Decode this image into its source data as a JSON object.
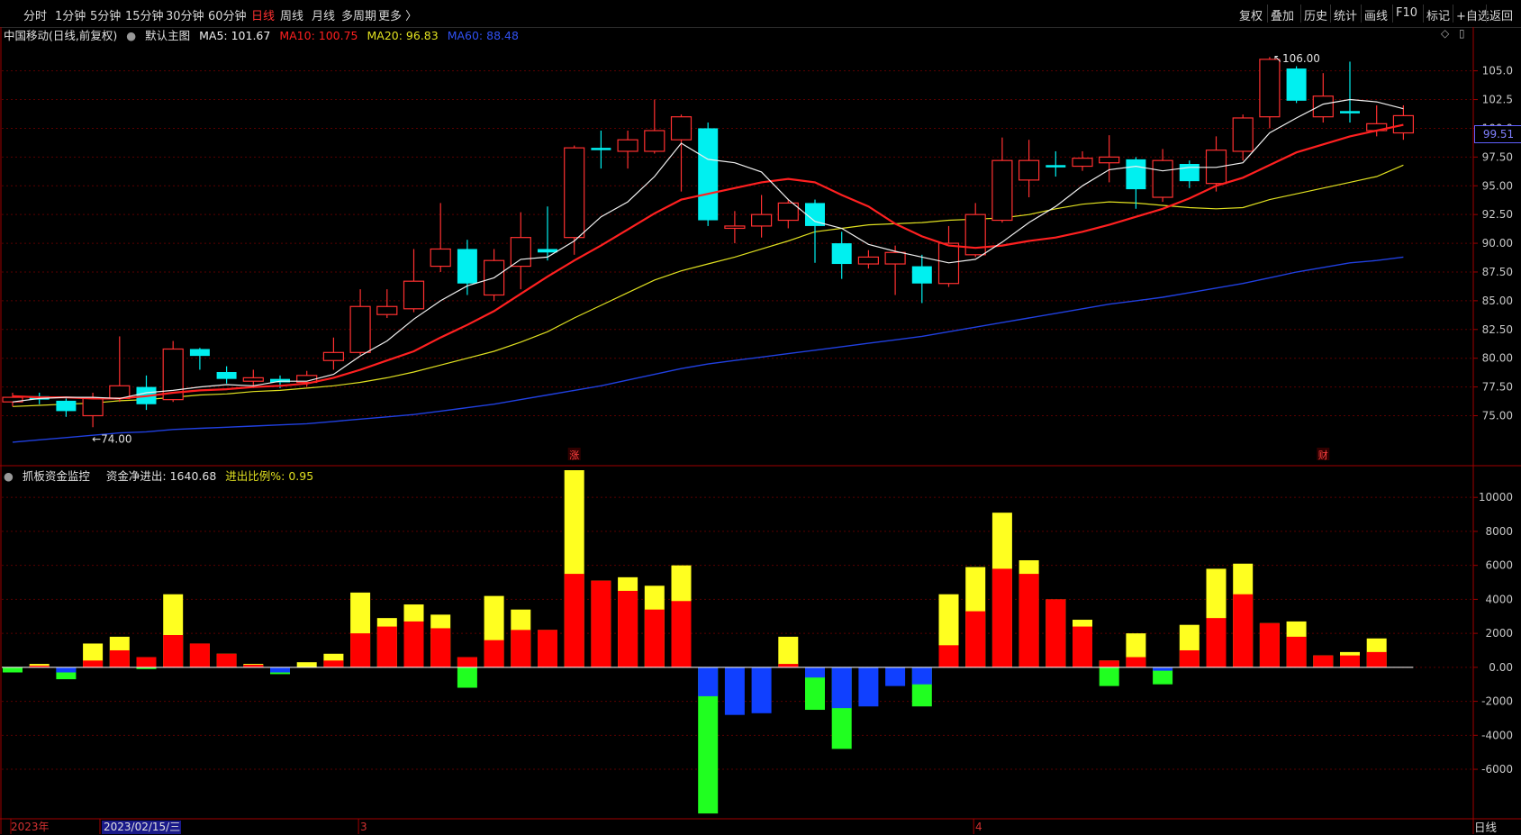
{
  "toolbar": {
    "periods": [
      "分时",
      "1分钟",
      "5分钟",
      "15分钟",
      "30分钟",
      "60分钟",
      "日线",
      "周线",
      "月线",
      "多周期",
      "更多 〉"
    ],
    "active_period": "日线",
    "right_buttons": [
      "复权",
      "叠加",
      "历史",
      "统计",
      "画线",
      "F10",
      "标记",
      "+自选",
      "返回"
    ]
  },
  "main_header": {
    "symbol": "中国移动(日线,前复权)",
    "template": "默认主图",
    "ma5": "MA5: 101.67",
    "ma10": "MA10: 100.75",
    "ma20": "MA20: 96.83",
    "ma60": "MA60: 88.48"
  },
  "sub_header": {
    "indicator": "抓板资金监控",
    "net_flow": "资金净进出: 1640.68",
    "ratio": "进出比例%: 0.95"
  },
  "current_price_tag": "99.51",
  "high_marker": "106.00",
  "low_marker": "←74.00",
  "event_markers": [
    "涨",
    "财"
  ],
  "x_labels": [
    "2023年",
    "2023/02/15/三",
    "3",
    "4"
  ],
  "freq_label": "日线",
  "colors": {
    "up": "#ff3030",
    "down": "#00f0f0",
    "ma5": "#f0f0f0",
    "ma10": "#ff2020",
    "ma20": "#e0e020",
    "ma60": "#2040e0",
    "bar_red": "#ff0000",
    "bar_yellow": "#ffff20",
    "bar_blue": "#1040ff",
    "bar_green": "#20ff20"
  },
  "chart_data": [
    {
      "type": "candlestick",
      "title": "中国移动(日线,前复权)",
      "y_ticks": [
        "105.0",
        "102.5",
        "100.0",
        "97.50",
        "95.00",
        "92.50",
        "90.00",
        "87.50",
        "85.00",
        "82.50",
        "80.00",
        "77.50",
        "75.00"
      ],
      "ylim": [
        71.2,
        107.4
      ],
      "candles": [
        {
          "o": 76.2,
          "c": 76.6,
          "h": 77.0,
          "l": 75.8
        },
        {
          "o": 76.7,
          "c": 76.4,
          "h": 77.0,
          "l": 76.0
        },
        {
          "o": 76.3,
          "c": 75.4,
          "h": 76.5,
          "l": 74.9
        },
        {
          "o": 75.0,
          "c": 76.5,
          "h": 77.0,
          "l": 74.0
        },
        {
          "o": 76.5,
          "c": 77.6,
          "h": 81.9,
          "l": 76.2
        },
        {
          "o": 77.5,
          "c": 76.0,
          "h": 78.5,
          "l": 75.5
        },
        {
          "o": 76.4,
          "c": 80.8,
          "h": 81.5,
          "l": 76.2
        },
        {
          "o": 80.8,
          "c": 80.2,
          "h": 80.9,
          "l": 79.0
        },
        {
          "o": 78.8,
          "c": 78.2,
          "h": 79.3,
          "l": 77.8
        },
        {
          "o": 78.0,
          "c": 78.3,
          "h": 79.0,
          "l": 77.4
        },
        {
          "o": 78.2,
          "c": 77.9,
          "h": 78.5,
          "l": 77.4
        },
        {
          "o": 77.9,
          "c": 78.5,
          "h": 78.9,
          "l": 77.5
        },
        {
          "o": 79.8,
          "c": 80.5,
          "h": 81.8,
          "l": 79.0
        },
        {
          "o": 80.5,
          "c": 84.5,
          "h": 86.0,
          "l": 80.3
        },
        {
          "o": 83.8,
          "c": 84.5,
          "h": 86.0,
          "l": 83.5
        },
        {
          "o": 84.3,
          "c": 86.7,
          "h": 89.5,
          "l": 84.0
        },
        {
          "o": 88.0,
          "c": 89.5,
          "h": 93.5,
          "l": 87.5
        },
        {
          "o": 89.5,
          "c": 86.5,
          "h": 90.3,
          "l": 85.5
        },
        {
          "o": 85.5,
          "c": 88.5,
          "h": 89.5,
          "l": 85.0
        },
        {
          "o": 88.0,
          "c": 90.5,
          "h": 92.7,
          "l": 86.0
        },
        {
          "o": 89.5,
          "c": 89.2,
          "h": 93.2,
          "l": 88.5
        },
        {
          "o": 90.5,
          "c": 98.3,
          "h": 98.5,
          "l": 89.0
        },
        {
          "o": 98.3,
          "c": 98.1,
          "h": 99.8,
          "l": 96.5
        },
        {
          "o": 98.0,
          "c": 99.0,
          "h": 99.8,
          "l": 96.5
        },
        {
          "o": 98.0,
          "c": 99.8,
          "h": 102.5,
          "l": 97.8
        },
        {
          "o": 99.0,
          "c": 101.0,
          "h": 101.2,
          "l": 94.5
        },
        {
          "o": 100.0,
          "c": 92.0,
          "h": 100.5,
          "l": 91.5
        },
        {
          "o": 91.3,
          "c": 91.5,
          "h": 92.8,
          "l": 90.0
        },
        {
          "o": 91.5,
          "c": 92.5,
          "h": 94.2,
          "l": 90.5
        },
        {
          "o": 92.0,
          "c": 93.5,
          "h": 93.8,
          "l": 91.3
        },
        {
          "o": 93.5,
          "c": 91.5,
          "h": 93.8,
          "l": 88.3
        },
        {
          "o": 90.0,
          "c": 88.2,
          "h": 91.0,
          "l": 86.9
        },
        {
          "o": 88.2,
          "c": 88.8,
          "h": 89.4,
          "l": 87.8
        },
        {
          "o": 88.2,
          "c": 89.2,
          "h": 89.8,
          "l": 85.5
        },
        {
          "o": 88.0,
          "c": 86.5,
          "h": 89.0,
          "l": 84.8
        },
        {
          "o": 86.5,
          "c": 90.0,
          "h": 91.5,
          "l": 86.2
        },
        {
          "o": 89.0,
          "c": 92.5,
          "h": 93.5,
          "l": 88.8
        },
        {
          "o": 92.0,
          "c": 97.2,
          "h": 99.2,
          "l": 91.8
        },
        {
          "o": 95.5,
          "c": 97.2,
          "h": 99.0,
          "l": 94.0
        },
        {
          "o": 96.8,
          "c": 96.6,
          "h": 98.0,
          "l": 95.8
        },
        {
          "o": 96.7,
          "c": 97.4,
          "h": 98.0,
          "l": 96.3
        },
        {
          "o": 97.0,
          "c": 97.5,
          "h": 99.4,
          "l": 95.3
        },
        {
          "o": 97.3,
          "c": 94.7,
          "h": 97.5,
          "l": 93.0
        },
        {
          "o": 94.0,
          "c": 97.2,
          "h": 98.2,
          "l": 93.6
        },
        {
          "o": 96.9,
          "c": 95.4,
          "h": 97.2,
          "l": 94.8
        },
        {
          "o": 95.2,
          "c": 98.1,
          "h": 99.3,
          "l": 94.5
        },
        {
          "o": 98.0,
          "c": 100.9,
          "h": 101.2,
          "l": 97.2
        },
        {
          "o": 101.0,
          "c": 106.0,
          "h": 106.2,
          "l": 100.0
        },
        {
          "o": 105.2,
          "c": 102.4,
          "h": 105.4,
          "l": 102.2
        },
        {
          "o": 101.0,
          "c": 102.8,
          "h": 104.8,
          "l": 100.5
        },
        {
          "o": 101.5,
          "c": 101.3,
          "h": 105.8,
          "l": 100.5
        },
        {
          "o": 99.8,
          "c": 100.4,
          "h": 102.0,
          "l": 99.3
        },
        {
          "o": 99.6,
          "c": 101.1,
          "h": 102.0,
          "l": 99.0
        }
      ],
      "ma5": [
        76.2,
        76.5,
        76.6,
        76.6,
        76.5,
        77.0,
        77.2,
        77.5,
        77.7,
        77.6,
        78.0,
        78.0,
        78.6,
        80.2,
        81.5,
        83.4,
        85.0,
        86.3,
        87.0,
        88.6,
        88.8,
        90.2,
        92.3,
        93.6,
        95.8,
        98.7,
        97.3,
        97.0,
        96.2,
        93.8,
        91.9,
        91.3,
        89.9,
        89.3,
        88.8,
        88.3,
        88.6,
        90.1,
        91.8,
        93.2,
        95.0,
        96.4,
        96.7,
        96.3,
        96.6,
        96.6,
        97.0,
        99.6,
        100.9,
        102.1,
        102.5,
        102.3,
        101.7
      ],
      "ma10": [
        76.7,
        76.6,
        76.6,
        76.5,
        76.5,
        76.7,
        77.0,
        77.2,
        77.3,
        77.5,
        77.6,
        77.8,
        78.3,
        79.0,
        79.8,
        80.6,
        81.8,
        82.9,
        84.1,
        85.6,
        87.1,
        88.5,
        89.8,
        91.2,
        92.6,
        93.8,
        94.3,
        94.8,
        95.3,
        95.6,
        95.3,
        94.2,
        93.2,
        91.7,
        90.6,
        89.8,
        89.6,
        89.8,
        90.2,
        90.5,
        91.0,
        91.6,
        92.3,
        93.0,
        93.9,
        95.0,
        95.7,
        96.8,
        97.9,
        98.6,
        99.3,
        99.8,
        100.3
      ],
      "ma20": [
        75.8,
        75.9,
        76.0,
        76.1,
        76.3,
        76.4,
        76.6,
        76.8,
        76.9,
        77.1,
        77.2,
        77.4,
        77.6,
        77.9,
        78.3,
        78.8,
        79.4,
        80.0,
        80.6,
        81.4,
        82.3,
        83.5,
        84.6,
        85.7,
        86.8,
        87.6,
        88.2,
        88.8,
        89.5,
        90.2,
        91.0,
        91.3,
        91.6,
        91.7,
        91.8,
        92.0,
        92.1,
        92.2,
        92.5,
        93.0,
        93.4,
        93.6,
        93.5,
        93.3,
        93.1,
        93.0,
        93.1,
        93.8,
        94.3,
        94.8,
        95.3,
        95.8,
        96.8
      ],
      "ma60": [
        72.7,
        72.9,
        73.1,
        73.3,
        73.5,
        73.6,
        73.8,
        73.9,
        74.0,
        74.1,
        74.2,
        74.3,
        74.5,
        74.7,
        74.9,
        75.1,
        75.4,
        75.7,
        76.0,
        76.4,
        76.8,
        77.2,
        77.6,
        78.1,
        78.6,
        79.1,
        79.5,
        79.8,
        80.1,
        80.4,
        80.7,
        81.0,
        81.3,
        81.6,
        81.9,
        82.3,
        82.7,
        83.1,
        83.5,
        83.9,
        84.3,
        84.7,
        85.0,
        85.3,
        85.7,
        86.1,
        86.5,
        87.0,
        87.5,
        87.9,
        88.3,
        88.5,
        88.8
      ]
    },
    {
      "type": "bar",
      "title": "抓板资金监控",
      "y_ticks": [
        "10000",
        "8000",
        "6000",
        "4000",
        "2000",
        "0.00",
        "-2000",
        "-4000",
        "-6000"
      ],
      "ylim": [
        -8700,
        11600
      ],
      "series": [
        {
          "name": "red",
          "values": [
            0,
            100,
            0,
            400,
            1000,
            600,
            1900,
            1400,
            800,
            150,
            0,
            0,
            400,
            2000,
            2400,
            2700,
            2300,
            600,
            1600,
            2200,
            2200,
            5500,
            5100,
            4500,
            3400,
            3900,
            0,
            0,
            0,
            200,
            0,
            0,
            0,
            0,
            0,
            1300,
            3300,
            5800,
            5500,
            4000,
            2400,
            400,
            600,
            0,
            1000,
            2900,
            4300,
            2600,
            1800,
            700,
            700,
            900,
            0
          ]
        },
        {
          "name": "yellow",
          "values": [
            0,
            200,
            0,
            1400,
            1800,
            600,
            4300,
            1400,
            800,
            200,
            0,
            300,
            800,
            4400,
            2900,
            3700,
            3100,
            600,
            4200,
            3400,
            2200,
            11600,
            5100,
            5300,
            4800,
            6000,
            0,
            0,
            0,
            1800,
            0,
            0,
            0,
            0,
            0,
            4300,
            5900,
            9100,
            6300,
            4000,
            2800,
            400,
            2000,
            0,
            2500,
            5800,
            6100,
            2600,
            2700,
            700,
            900,
            1700,
            0
          ]
        },
        {
          "name": "blue",
          "values": [
            0,
            0,
            -300,
            0,
            0,
            0,
            0,
            0,
            0,
            0,
            -300,
            0,
            0,
            0,
            0,
            0,
            0,
            0,
            0,
            0,
            0,
            0,
            0,
            0,
            0,
            0,
            -1700,
            -2800,
            -2700,
            0,
            -600,
            -2400,
            -2300,
            -1100,
            -1000,
            0,
            0,
            0,
            0,
            0,
            0,
            0,
            0,
            -200,
            0,
            0,
            0,
            0,
            0,
            0,
            0,
            0,
            0
          ]
        },
        {
          "name": "green",
          "values": [
            -300,
            0,
            -700,
            0,
            0,
            -100,
            0,
            0,
            0,
            0,
            -400,
            0,
            0,
            0,
            0,
            0,
            0,
            -1200,
            0,
            0,
            0,
            0,
            0,
            0,
            0,
            0,
            -8600,
            0,
            0,
            0,
            -2500,
            -4800,
            0,
            0,
            -2300,
            0,
            0,
            0,
            0,
            0,
            0,
            -1100,
            0,
            -1000,
            0,
            0,
            0,
            0,
            0,
            0,
            0,
            0,
            0
          ]
        }
      ]
    }
  ]
}
